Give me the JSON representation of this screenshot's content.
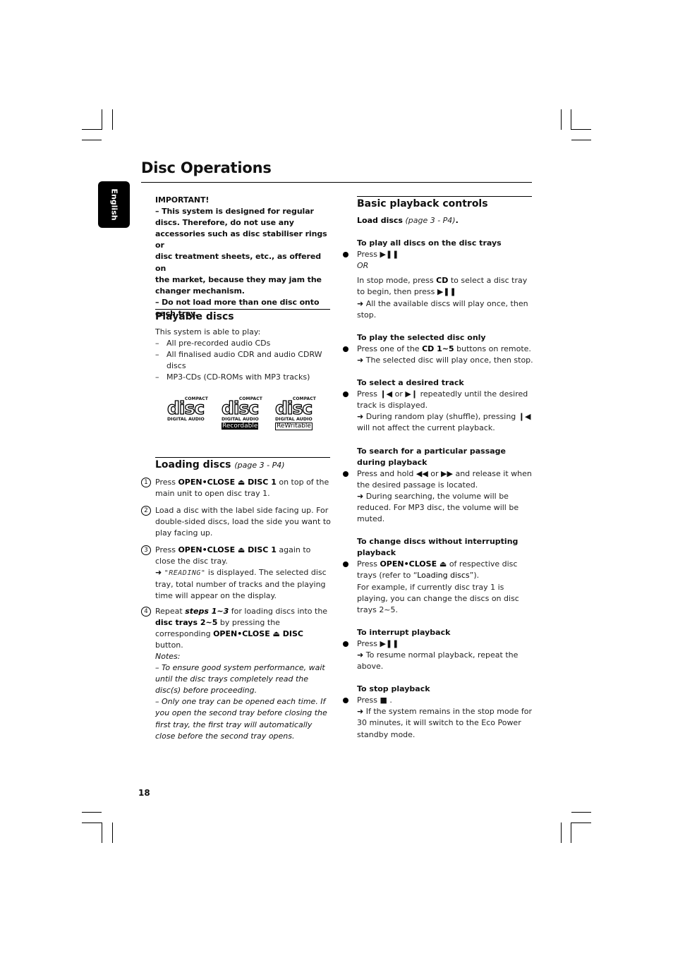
{
  "page": {
    "title": "Disc Operations",
    "language_tab": "English",
    "page_number": "18"
  },
  "important": {
    "heading": "IMPORTANT!",
    "lines": [
      "–  This system is designed for regular",
      "discs. Therefore, do not use any",
      "accessories such as disc stabiliser rings or",
      "disc treatment sheets, etc., as offered on",
      "the market, because they may jam the",
      "changer mechanism.",
      "–  Do not load more than one disc onto",
      "each tray."
    ]
  },
  "playable": {
    "title": "Playable discs",
    "intro": "This system is able to play:",
    "items": [
      "All pre-recorded audio CDs",
      "All finalised audio CDR and audio CDRW discs",
      "MP3-CDs (CD-ROMs with MP3 tracks)"
    ],
    "dash": "–",
    "logos": [
      {
        "top": "COMPACT",
        "word": "disc",
        "bottom": "DIGITAL AUDIO",
        "tag": ""
      },
      {
        "top": "COMPACT",
        "word": "disc",
        "bottom": "DIGITAL AUDIO",
        "tag": "Recordable"
      },
      {
        "top": "COMPACT",
        "word": "disc",
        "bottom": "DIGITAL AUDIO",
        "tag": "ReWritable"
      }
    ]
  },
  "loading": {
    "title": "Loading discs",
    "ref": "(page 3 - P4)",
    "steps": [
      {
        "num": "1",
        "parts": [
          {
            "t": "Press ",
            "s": "p"
          },
          {
            "t": "OPEN•CLOSE ⏏ DISC 1",
            "s": "b"
          },
          {
            "t": " on top of the main unit to open disc tray 1.",
            "s": "p"
          }
        ]
      },
      {
        "num": "2",
        "parts": [
          {
            "t": "Load a disc with the label side facing up. For double-sided discs, load the side you want to play facing up.",
            "s": "p"
          }
        ]
      },
      {
        "num": "3",
        "parts": [
          {
            "t": "Press ",
            "s": "p"
          },
          {
            "t": "OPEN•CLOSE ⏏ DISC 1",
            "s": "b"
          },
          {
            "t": " again to close the disc tray.",
            "s": "p"
          }
        ],
        "arrow_parts": [
          {
            "t": "\"READING\"",
            "s": "lcd"
          },
          {
            "t": " is displayed. The selected disc tray, total number of tracks and the playing time will appear on the display.",
            "s": "p"
          }
        ]
      },
      {
        "num": "4",
        "parts": [
          {
            "t": "Repeat ",
            "s": "p"
          },
          {
            "t": "steps 1~3",
            "s": "bi"
          },
          {
            "t": " for loading discs into the ",
            "s": "p"
          },
          {
            "t": "disc trays 2~5",
            "s": "b"
          },
          {
            "t": " by pressing the corresponding ",
            "s": "p"
          },
          {
            "t": "OPEN•CLOSE ⏏  DISC",
            "s": "b"
          },
          {
            "t": " button.",
            "s": "p"
          }
        ]
      }
    ],
    "notes_label": "Notes:",
    "notes": [
      "–  To ensure good system performance, wait until the disc trays completely read the disc(s) before proceeding.",
      "–  Only one tray can be opened each time.  If you open the second tray before closing the first tray, the first tray will automatically close before the second tray opens."
    ]
  },
  "basic": {
    "title": "Basic playback controls",
    "load_label": "Load discs",
    "load_ref": "(page 3 - P4)",
    "arrow": "➜",
    "sections": [
      {
        "heading": "To play all discs on the disc trays",
        "bullet": [
          {
            "t": "Press ",
            "s": "p"
          },
          {
            "t": "▶❚❚",
            "s": "g"
          }
        ],
        "extra": [
          {
            "kind": "line",
            "parts": [
              {
                "t": "OR",
                "s": "i"
              }
            ]
          },
          {
            "kind": "gap"
          },
          {
            "kind": "line",
            "parts": [
              {
                "t": "In stop mode, press ",
                "s": "p"
              },
              {
                "t": "CD",
                "s": "b"
              },
              {
                "t": " to select a disc tray to begin, then press ",
                "s": "p"
              },
              {
                "t": "▶❚❚",
                "s": "g"
              }
            ]
          },
          {
            "kind": "arrow",
            "parts": [
              {
                "t": "All the available discs will play once, then stop.",
                "s": "p"
              }
            ]
          }
        ]
      },
      {
        "heading": "To play the selected disc only",
        "bullet": [
          {
            "t": "Press one of the ",
            "s": "p"
          },
          {
            "t": "CD 1~5",
            "s": "b"
          },
          {
            "t": " buttons on remote.",
            "s": "p"
          }
        ],
        "extra": [
          {
            "kind": "arrow",
            "parts": [
              {
                "t": "The selected disc will play once, then stop.",
                "s": "p"
              }
            ]
          }
        ]
      },
      {
        "heading": "To select a desired track",
        "bullet": [
          {
            "t": "Press ",
            "s": "p"
          },
          {
            "t": "❙◀",
            "s": "g"
          },
          {
            "t": " or ",
            "s": "p"
          },
          {
            "t": "▶❙",
            "s": "g"
          },
          {
            "t": " repeatedly until the desired track is displayed.",
            "s": "p"
          }
        ],
        "extra": [
          {
            "kind": "arrow",
            "parts": [
              {
                "t": "During random play (shuffle), pressing ",
                "s": "p"
              },
              {
                "t": "❙◀",
                "s": "g"
              },
              {
                "t": " will not affect the current playback.",
                "s": "p"
              }
            ]
          }
        ]
      },
      {
        "heading": "To search for a particular passage during playback",
        "bullet": [
          {
            "t": "Press and hold ",
            "s": "p"
          },
          {
            "t": "◀◀",
            "s": "g"
          },
          {
            "t": " or ",
            "s": "p"
          },
          {
            "t": "▶▶",
            "s": "g"
          },
          {
            "t": " and release it when the desired passage is located.",
            "s": "p"
          }
        ],
        "extra": [
          {
            "kind": "arrow",
            "parts": [
              {
                "t": "During searching, the volume will be reduced. For MP3 disc, the volume will be muted.",
                "s": "p"
              }
            ]
          }
        ]
      },
      {
        "heading": "To change discs without interrupting playback",
        "bullet": [
          {
            "t": "Press ",
            "s": "p"
          },
          {
            "t": "OPEN•CLOSE ⏏",
            "s": "b"
          },
          {
            "t": " of respective disc trays (refer to “",
            "s": "p"
          },
          {
            "t": "Loading discs",
            "s": "m"
          },
          {
            "t": "”).",
            "s": "p"
          }
        ],
        "extra": [
          {
            "kind": "line",
            "parts": [
              {
                "t": "For example, if currently disc tray 1 is playing, you can change the discs on disc trays 2~5.",
                "s": "p"
              }
            ]
          }
        ]
      },
      {
        "heading": "To interrupt playback",
        "bullet": [
          {
            "t": "Press ",
            "s": "p"
          },
          {
            "t": "▶❚❚",
            "s": "g"
          }
        ],
        "extra": [
          {
            "kind": "arrow",
            "parts": [
              {
                "t": "To resume normal playback, repeat the above.",
                "s": "p"
              }
            ]
          }
        ]
      },
      {
        "heading": "To stop playback",
        "bullet": [
          {
            "t": "Press ",
            "s": "p"
          },
          {
            "t": "■",
            "s": "g"
          },
          {
            "t": " .",
            "s": "p"
          }
        ],
        "extra": [
          {
            "kind": "arrow",
            "parts": [
              {
                "t": "If the system remains in the stop mode for 30 minutes, it will switch to the Eco Power standby mode.",
                "s": "p"
              }
            ]
          }
        ]
      }
    ]
  }
}
